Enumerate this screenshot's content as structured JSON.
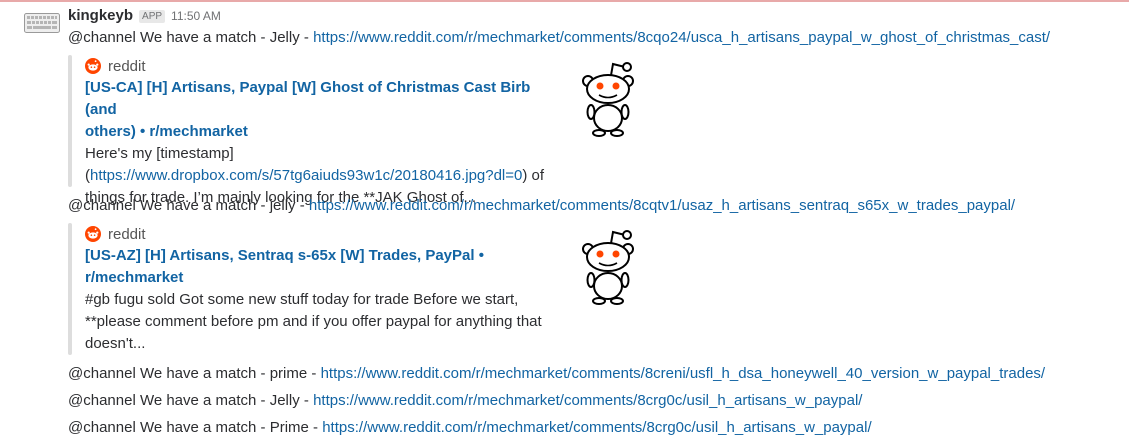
{
  "sender": {
    "name": "kingkeyb",
    "badge": "APP",
    "time": "11:50 AM"
  },
  "messages": [
    {
      "prefix": "@channel We have a match - Jelly - ",
      "url": "https://www.reddit.com/r/mechmarket/comments/8cqo24/usca_h_artisans_paypal_w_ghost_of_christmas_cast/"
    },
    {
      "prefix": "@channel We have a match - jelly - ",
      "url": "https://www.reddit.com/r/mechmarket/comments/8cqtv1/usaz_h_artisans_sentraq_s65x_w_trades_paypal/"
    },
    {
      "prefix": "@channel We have a match - prime - ",
      "url": "https://www.reddit.com/r/mechmarket/comments/8creni/usfl_h_dsa_honeywell_40_version_w_paypal_trades/"
    },
    {
      "prefix": "@channel We have a match - Jelly - ",
      "url": "https://www.reddit.com/r/mechmarket/comments/8crg0c/usil_h_artisans_w_paypal/"
    },
    {
      "prefix": "@channel We have a match - Prime - ",
      "url": "https://www.reddit.com/r/mechmarket/comments/8crg0c/usil_h_artisans_w_paypal/"
    }
  ],
  "unfurls": [
    {
      "service": "reddit",
      "title_line1": "[US-CA] [H] Artisans, Paypal [W] Ghost of Christmas Cast Birb (and",
      "title_line2": "others) • r/mechmarket",
      "body_line1": "Here's my [timestamp]",
      "body_line2_pre": "(",
      "body_line2_link": "https://www.dropbox.com/s/57tg6aiuds93w1c/20180416.jpg?dl=0",
      "body_line2_post": ") of",
      "body_line3": "things for trade. I’m mainly looking for the **JAK Ghost of..."
    },
    {
      "service": "reddit",
      "title_line1": "[US-AZ] [H] Artisans, Sentraq s-65x [W] Trades, PayPal •",
      "title_line2": "r/mechmarket",
      "body_line1": "#gb fugu sold Got some new stuff today for trade Before we start,",
      "body_line2": "**please comment before pm and if you offer paypal for anything that",
      "body_line3": "doesn't..."
    }
  ],
  "colors": {
    "link": "#1264a3",
    "reddit_orange": "#ff4500",
    "unfurl_bar": "#dddddd"
  },
  "icons": {
    "avatar": "keyboard-avatar",
    "service": "reddit-icon",
    "thumbnail": "reddit-alien-icon"
  }
}
